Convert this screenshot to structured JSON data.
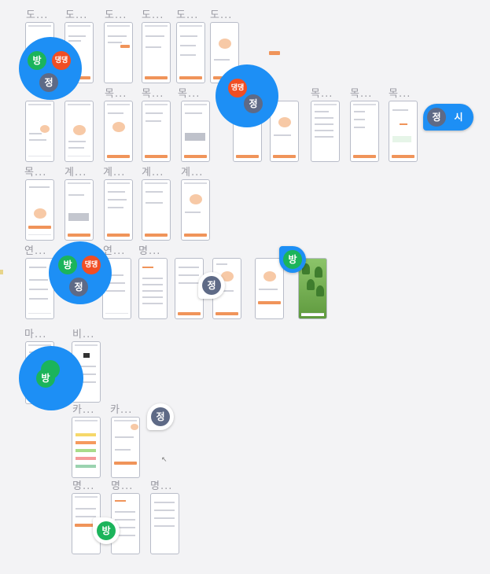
{
  "row_labels": {
    "r1": [
      "도...",
      "도...",
      "도...",
      "도...",
      "도...",
      "도..."
    ],
    "r2": [
      "목...",
      "목...",
      "목...",
      "목...",
      "목...",
      "목...",
      "목..."
    ],
    "r3": [
      "목...",
      "계...",
      "계...",
      "계...",
      "계..."
    ],
    "r4": [
      "연...",
      "연...",
      "명..."
    ],
    "r5": [
      "마...",
      "비..."
    ],
    "r6": [
      "카...",
      "카..."
    ],
    "r7": [
      "명...",
      "명...",
      "명..."
    ]
  },
  "avatars": {
    "bang": "방",
    "daengdaeng": "댕댕",
    "jeong": "정",
    "si": "시"
  },
  "colors": {
    "cluster_blue": "#1d8ff5",
    "avatar_green": "#1bb45b",
    "avatar_red": "#f04e24",
    "avatar_slate": "#5e6a86",
    "accent_orange": "#f0945a"
  }
}
